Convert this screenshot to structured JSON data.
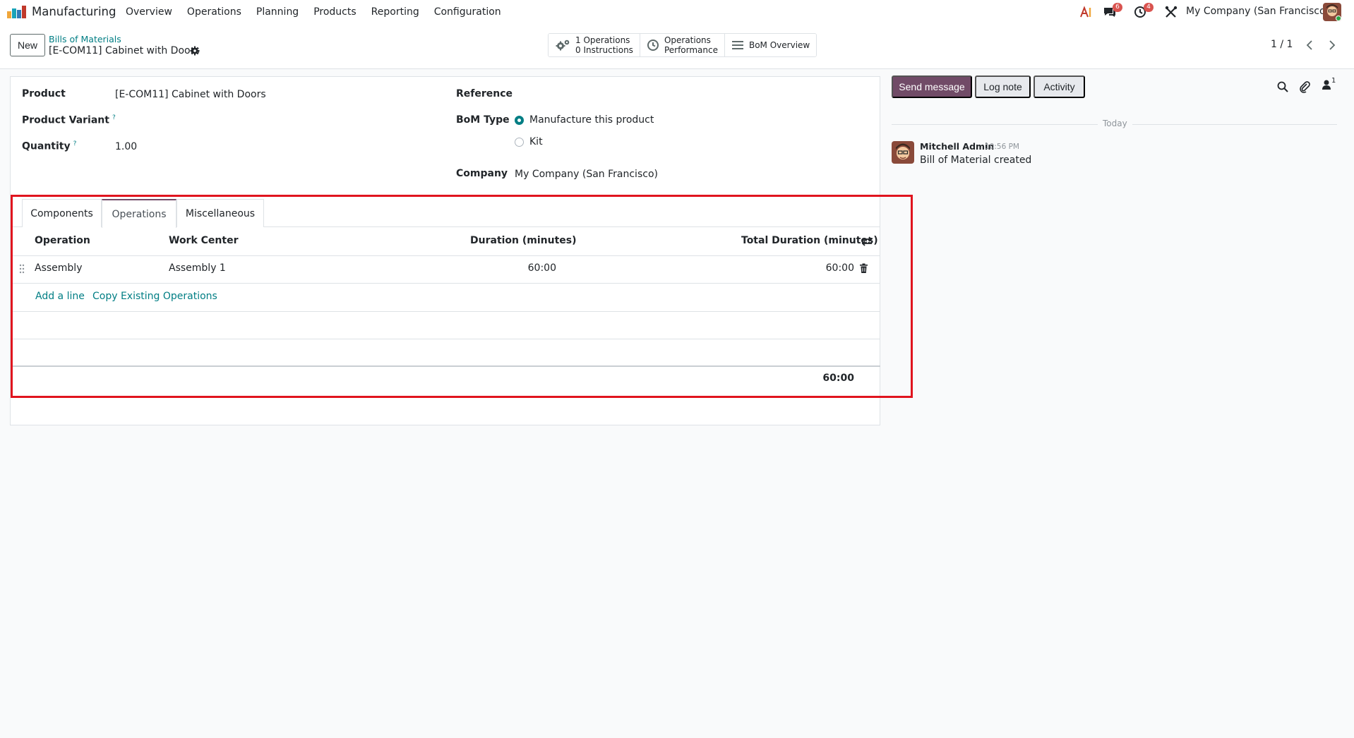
{
  "navbar": {
    "app_name": "Manufacturing",
    "menu": [
      "Overview",
      "Operations",
      "Planning",
      "Products",
      "Reporting",
      "Configuration"
    ],
    "messages_badge": "6",
    "activities_badge": "4",
    "company": "My Company (San Francisco)"
  },
  "control": {
    "new_label": "New",
    "breadcrumb_parent": "Bills of Materials",
    "breadcrumb_current": "[E-COM11] Cabinet with Doors",
    "smart_buttons": {
      "operations_line1": "1 Operations",
      "operations_line2": "0 Instructions",
      "performance_line1": "Operations",
      "performance_line2": "Performance",
      "bom_overview": "BoM Overview"
    },
    "pager": "1 / 1"
  },
  "form": {
    "product_label": "Product",
    "product_value": "[E-COM11] Cabinet with Doors",
    "variant_label": "Product Variant",
    "quantity_label": "Quantity",
    "quantity_value": "1.00",
    "help_mark": "?",
    "reference_label": "Reference",
    "bom_type_label": "BoM Type",
    "bom_type_options": [
      "Manufacture this product",
      "Kit"
    ],
    "bom_type_selected": "Manufacture this product",
    "company_label": "Company",
    "company_value": "My Company (San Francisco)"
  },
  "tabs": [
    "Components",
    "Operations",
    "Miscellaneous"
  ],
  "active_tab": "Operations",
  "table": {
    "headers": [
      "Operation",
      "Work Center",
      "Duration (minutes)",
      "Total Duration (minutes)"
    ],
    "rows": [
      {
        "operation": "Assembly",
        "work_center": "Assembly 1",
        "duration": "60:00",
        "total_duration": "60:00"
      }
    ],
    "add_line": "Add a line",
    "copy_operations": "Copy Existing Operations",
    "total": "60:00"
  },
  "chatter": {
    "send_message": "Send message",
    "log_note": "Log note",
    "activity": "Activity",
    "followers_count": "1",
    "today": "Today",
    "message": {
      "author": "Mitchell Admin",
      "time": "10:56 PM",
      "body": "Bill of Material created"
    }
  },
  "colors": {
    "brand": "#714b67",
    "link": "#017e84",
    "highlight": "#e0141e"
  }
}
